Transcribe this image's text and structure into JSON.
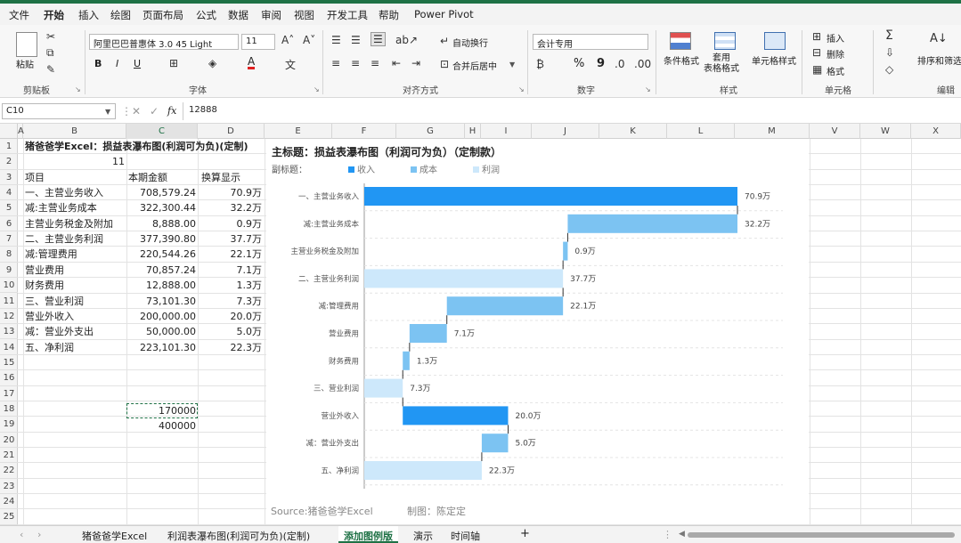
{
  "menu": {
    "items": [
      "文件",
      "开始",
      "插入",
      "绘图",
      "页面布局",
      "公式",
      "数据",
      "审阅",
      "视图",
      "开发工具",
      "帮助",
      "Power Pivot"
    ],
    "active_index": 1,
    "accent": "#1e7145"
  },
  "ribbon": {
    "clipboard": {
      "paste": "粘贴",
      "label": "剪贴板"
    },
    "font": {
      "name": "阿里巴巴普惠体 3.0 45 Light",
      "size": "11",
      "bold": "B",
      "italic": "I",
      "underline": "U",
      "font_color_glyph": "A",
      "label": "字体"
    },
    "alignment": {
      "wrap": "自动换行",
      "merge": "合并后居中",
      "label": "对齐方式"
    },
    "number": {
      "format": "会计专用",
      "percent": "%",
      "comma": "9",
      "label": "数字"
    },
    "styles": {
      "conditional": "条件格式",
      "table": "套用\n表格格式",
      "cell": "单元格样式",
      "label": "样式"
    },
    "cells": {
      "insert": "插入",
      "delete": "删除",
      "format": "格式",
      "label": "单元格"
    },
    "editing": {
      "sort": "排序和筛选",
      "label": "编辑"
    }
  },
  "formula_bar": {
    "name_box": "C10",
    "fx": "fx",
    "value": "12888"
  },
  "columns": [
    "A",
    "B",
    "C",
    "D",
    "E",
    "F",
    "G",
    "H",
    "I",
    "J",
    "K",
    "L",
    "M",
    "V",
    "W",
    "X"
  ],
  "rows": [
    "1",
    "2",
    "3",
    "4",
    "5",
    "6",
    "7",
    "8",
    "9",
    "10",
    "11",
    "12",
    "13",
    "14",
    "15",
    "16",
    "17",
    "18",
    "19",
    "20",
    "21",
    "22",
    "23",
    "24",
    "25"
  ],
  "sheet": {
    "title": "猪爸爸学Excel：损益表瀑布图(利润可为负)(定制)",
    "b2": "11",
    "headers": [
      "项目",
      "本期金额",
      "换算显示"
    ],
    "items": [
      {
        "name": "一、主营业务收入",
        "amount": "708,579.24",
        "display": "70.9万"
      },
      {
        "name": "减:主营业务成本",
        "amount": "322,300.44",
        "display": "32.2万"
      },
      {
        "name": "  主营业务税金及附加",
        "amount": "8,888.00",
        "display": "0.9万"
      },
      {
        "name": "二、主营业务利润",
        "amount": "377,390.80",
        "display": "37.7万"
      },
      {
        "name": "减:管理费用",
        "amount": "220,544.26",
        "display": "22.1万"
      },
      {
        "name": "  营业费用",
        "amount": "70,857.24",
        "display": "7.1万"
      },
      {
        "name": "  财务费用",
        "amount": "12,888.00",
        "display": "1.3万"
      },
      {
        "name": "三、营业利润",
        "amount": "73,101.30",
        "display": "7.3万"
      },
      {
        "name": "营业外收入",
        "amount": "200,000.00",
        "display": "20.0万"
      },
      {
        "name": "减：营业外支出",
        "amount": "50,000.00",
        "display": "5.0万"
      },
      {
        "name": "五、净利润",
        "amount": "223,101.30",
        "display": "22.3万"
      }
    ],
    "c18": "170000",
    "c19": "400000"
  },
  "chart_data": {
    "type": "bar",
    "title": "主标题：损益表瀑布图（利润可为负）（定制款）",
    "subtitle_label": "副标题：",
    "legend": [
      {
        "name": "收入",
        "color": "#2196f3"
      },
      {
        "name": "成本",
        "color": "#7cc3f2"
      },
      {
        "name": "利润",
        "color": "#cde8fb"
      }
    ],
    "categories": [
      "一、主营业务收入",
      "减:主营业务成本",
      "主营业务税金及附加",
      "二、主营业务利润",
      "减:管理费用",
      "营业费用",
      "财务费用",
      "三、营业利润",
      "营业外收入",
      "减：营业外支出",
      "五、净利润"
    ],
    "bars": [
      {
        "start": 0,
        "end": 70.86,
        "kind": "收入",
        "label": "70.9万"
      },
      {
        "start": 38.63,
        "end": 70.86,
        "kind": "成本",
        "label": "32.2万"
      },
      {
        "start": 37.74,
        "end": 38.63,
        "kind": "成本",
        "label": "0.9万"
      },
      {
        "start": 0,
        "end": 37.74,
        "kind": "利润",
        "label": "37.7万"
      },
      {
        "start": 15.68,
        "end": 37.74,
        "kind": "成本",
        "label": "22.1万"
      },
      {
        "start": 8.6,
        "end": 15.68,
        "kind": "成本",
        "label": "7.1万"
      },
      {
        "start": 7.31,
        "end": 8.6,
        "kind": "成本",
        "label": "1.3万"
      },
      {
        "start": 0,
        "end": 7.31,
        "kind": "利润",
        "label": "7.3万"
      },
      {
        "start": 7.31,
        "end": 27.31,
        "kind": "收入",
        "label": "20.0万"
      },
      {
        "start": 22.31,
        "end": 27.31,
        "kind": "成本",
        "label": "5.0万"
      },
      {
        "start": 0,
        "end": 22.31,
        "kind": "利润",
        "label": "22.3万"
      }
    ],
    "xlim": [
      0,
      70.86
    ],
    "source": "Source:猪爸爸学Excel",
    "author": "制图：陈定定"
  },
  "tabs": {
    "items": [
      "猪爸爸学Excel",
      "利润表瀑布图(利润可为负)(定制)",
      "添加图例版",
      "演示",
      "时间轴"
    ],
    "active_index": 2,
    "add": "+"
  }
}
